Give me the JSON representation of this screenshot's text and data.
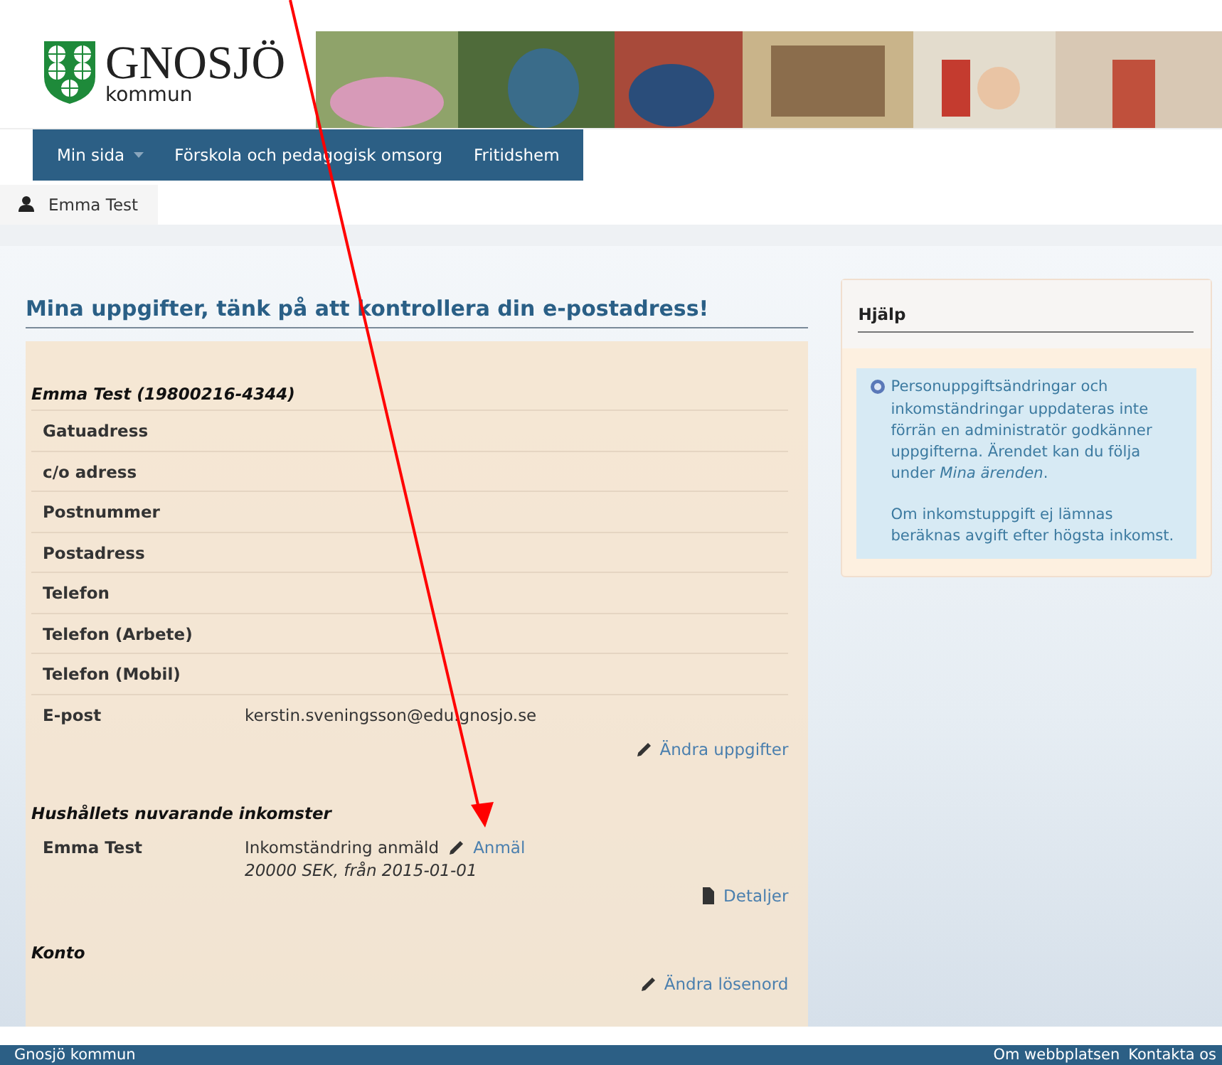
{
  "logo": {
    "name": "GNOSJÖ",
    "subtitle": "kommun"
  },
  "nav": [
    {
      "label": "Min sida",
      "has_menu": true
    },
    {
      "label": "Förskola och pedagogisk omsorg",
      "has_menu": false
    },
    {
      "label": "Fritidshem",
      "has_menu": false
    }
  ],
  "user": {
    "name": "Emma Test"
  },
  "main": {
    "title": "Mina uppgifter, tänk på att kontrollera din e-postadress!",
    "person_heading": "Emma Test (19800216-4344)",
    "fields": [
      {
        "label": "Gatuadress"
      },
      {
        "label": "c/o adress"
      },
      {
        "label": "Postnummer"
      },
      {
        "label": "Postadress"
      },
      {
        "label": "Telefon"
      },
      {
        "label": "Telefon (Arbete)"
      },
      {
        "label": "Telefon (Mobil)"
      },
      {
        "label": "E-post",
        "value": "kerstin.sveningsson@edu.gnosjo.se"
      }
    ],
    "edit_link": "Ändra uppgifter",
    "income": {
      "heading": "Hushållets nuvarande inkomster",
      "rows": [
        {
          "name": "Emma Test",
          "status": "Inkomständring anmäld",
          "link": "Anmäl",
          "detail": "20000 SEK, från 2015-01-01"
        }
      ],
      "details_link": "Detaljer"
    },
    "account": {
      "heading": "Konto",
      "link": "Ändra lösenord"
    }
  },
  "help": {
    "title": "Hjälp",
    "paragraphs": [
      "Personuppgiftsändringar och inkomständringar uppdateras inte förrän en administratör godkänner uppgifterna. Ärendet kan du följa under *Mina ärenden*.",
      "Om inkomstuppgift ej lämnas beräknas avgift efter högsta inkomst."
    ]
  },
  "footer": {
    "left": "Gnosjö kommun",
    "links": [
      "Om webbplatsen",
      "Kontakta os"
    ]
  }
}
